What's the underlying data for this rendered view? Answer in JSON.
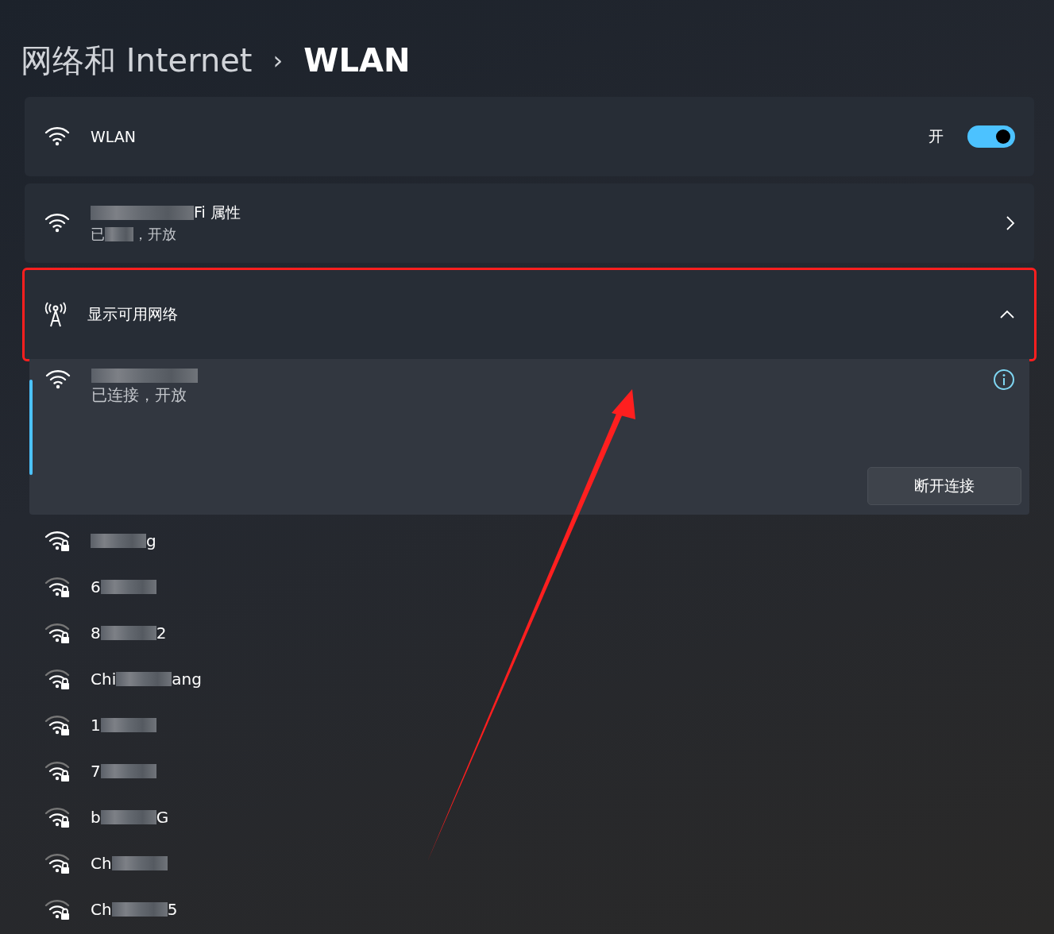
{
  "breadcrumb": {
    "parent": "网络和 Internet",
    "separator": "›",
    "current": "WLAN"
  },
  "wlan_card": {
    "label": "WLAN",
    "state_text": "开",
    "on": true
  },
  "properties_card": {
    "name_end": "Fi 属性",
    "status_start": "已",
    "status_end": "，开放"
  },
  "available_card": {
    "label": "显示可用网络",
    "expanded": true,
    "highlighted": true
  },
  "connected_network": {
    "status": "已连接，开放",
    "selected": true,
    "button": "断开连接"
  },
  "networks": [
    {
      "name_end": "g",
      "strong": true
    },
    {
      "name_start": "6",
      "strong": false
    },
    {
      "name_start": "8",
      "name_end": "2",
      "strong": false
    },
    {
      "name_start": "Chi",
      "name_end": "ang",
      "strong": false
    },
    {
      "name_start": "1",
      "strong": false
    },
    {
      "name_start": "7",
      "strong": false
    },
    {
      "name_start": "b",
      "name_end": "G",
      "strong": false
    },
    {
      "name_start": "Ch",
      "strong": false
    },
    {
      "name_start": "Ch",
      "name_end": "5",
      "strong": false
    }
  ],
  "annotation": {
    "kind": "arrow"
  }
}
